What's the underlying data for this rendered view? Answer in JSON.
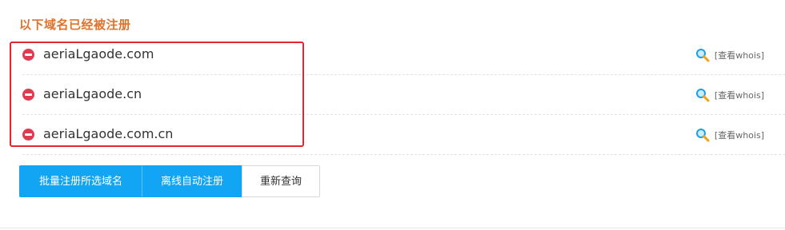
{
  "section": {
    "title": "以下域名已经被注册"
  },
  "domains": [
    {
      "name": "aeriaLgaode.com",
      "whois_label": "[查看whois]"
    },
    {
      "name": "aeriaLgaode.cn",
      "whois_label": "[查看whois]"
    },
    {
      "name": "aeriaLgaode.com.cn",
      "whois_label": "[查看whois]"
    }
  ],
  "actions": {
    "batch_register": "批量注册所选域名",
    "offline_register": "离线自动注册",
    "requery": "重新查询"
  },
  "colors": {
    "title": "#e0722b",
    "status_registered": "#e23b4f",
    "primary_button": "#12a5f4",
    "highlight_border": "#e2262f"
  },
  "icons": {
    "status": "no-entry-icon",
    "whois": "search-icon"
  }
}
